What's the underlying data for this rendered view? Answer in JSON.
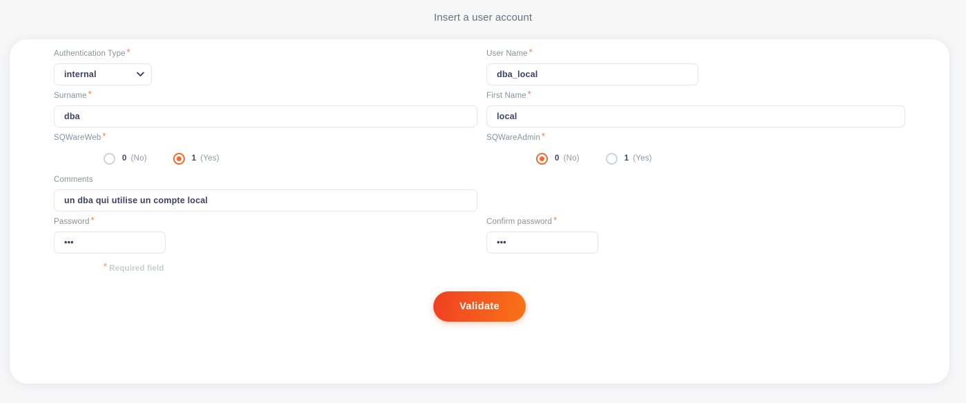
{
  "page": {
    "title": "Insert a user account",
    "accent_color": "#f4682a",
    "required_marker": "*",
    "required_note": "Required field"
  },
  "form": {
    "authentication_type": {
      "label": "Authentication Type",
      "value": "internal",
      "options": [
        "internal"
      ]
    },
    "user_name": {
      "label": "User Name",
      "value": "dba_local"
    },
    "surname": {
      "label": "Surname",
      "value": "dba"
    },
    "first_name": {
      "label": "First Name",
      "value": "local"
    },
    "sqwareweb": {
      "label": "SQWareWeb",
      "options": [
        {
          "value": "0",
          "text": "(No)",
          "selected": false
        },
        {
          "value": "1",
          "text": "(Yes)",
          "selected": true
        }
      ]
    },
    "sqwareadmin": {
      "label": "SQWareAdmin",
      "options": [
        {
          "value": "0",
          "text": "(No)",
          "selected": true
        },
        {
          "value": "1",
          "text": "(Yes)",
          "selected": false
        }
      ]
    },
    "comments": {
      "label": "Comments",
      "value": "un dba qui utilise un compte local"
    },
    "password": {
      "label": "Password",
      "value": "•••"
    },
    "confirm_password": {
      "label": "Confirm password",
      "value": "•••"
    },
    "submit": {
      "label": "Validate"
    }
  }
}
